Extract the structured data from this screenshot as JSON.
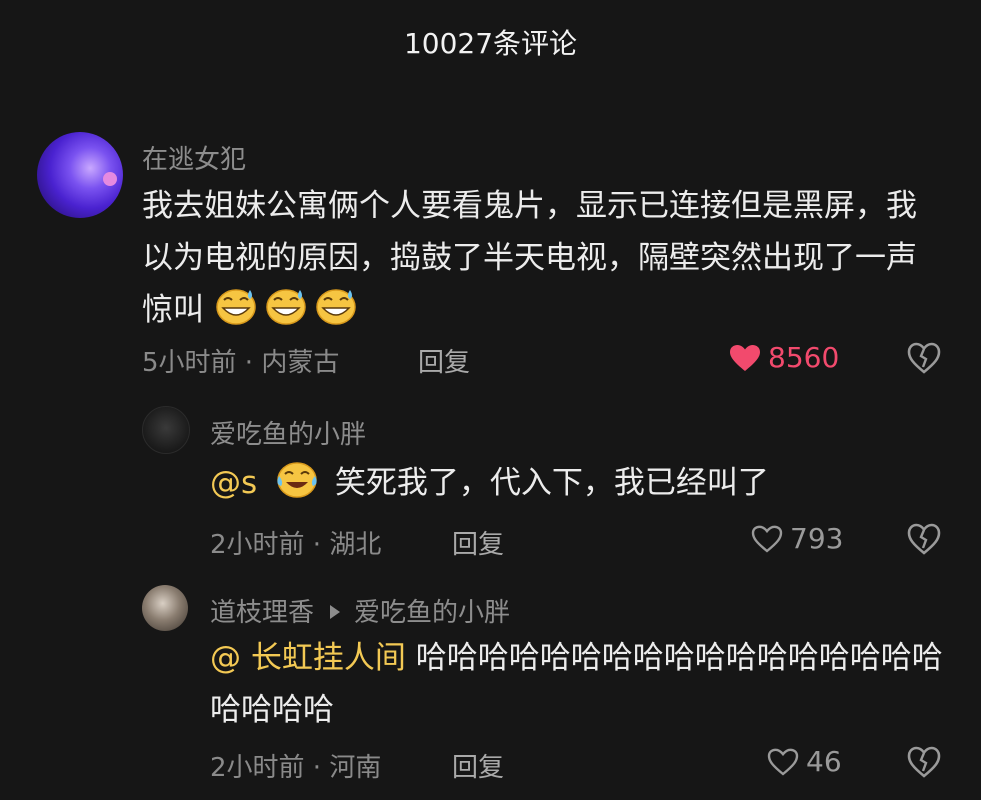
{
  "header": {
    "title": "10027条评论"
  },
  "comments": [
    {
      "username": "在逃女犯",
      "text": "我去姐妹公寓俩个人要看鬼片，显示已连接但是黑屏，我以为电视的原因，捣鼓了半天电视，隔壁突然出现了一声惊叫",
      "emojis": [
        "sweat-grin-emoji",
        "sweat-grin-emoji",
        "sweat-grin-emoji"
      ],
      "meta": "5小时前 · 内蒙古",
      "reply_label": "回复",
      "likes": "8560",
      "liked": true
    }
  ],
  "replies": [
    {
      "username": "爱吃鱼的小胖",
      "mention": "@s",
      "emoji": "tears-of-joy-emoji",
      "text": "笑死我了，代入下，我已经叫了",
      "meta": "2小时前 · 湖北",
      "reply_label": "回复",
      "likes": "793"
    },
    {
      "username": "道枝理香",
      "reply_to": "爱吃鱼的小胖",
      "mention": "@ 长虹挂人间",
      "text": "哈哈哈哈哈哈哈哈哈哈哈哈哈哈哈哈哈哈哈哈哈",
      "meta": "2小时前 · 河南",
      "reply_label": "回复",
      "likes": "46"
    }
  ],
  "colors": {
    "background": "#161616",
    "like_active": "#f24a6d",
    "mention": "#f3c954"
  }
}
